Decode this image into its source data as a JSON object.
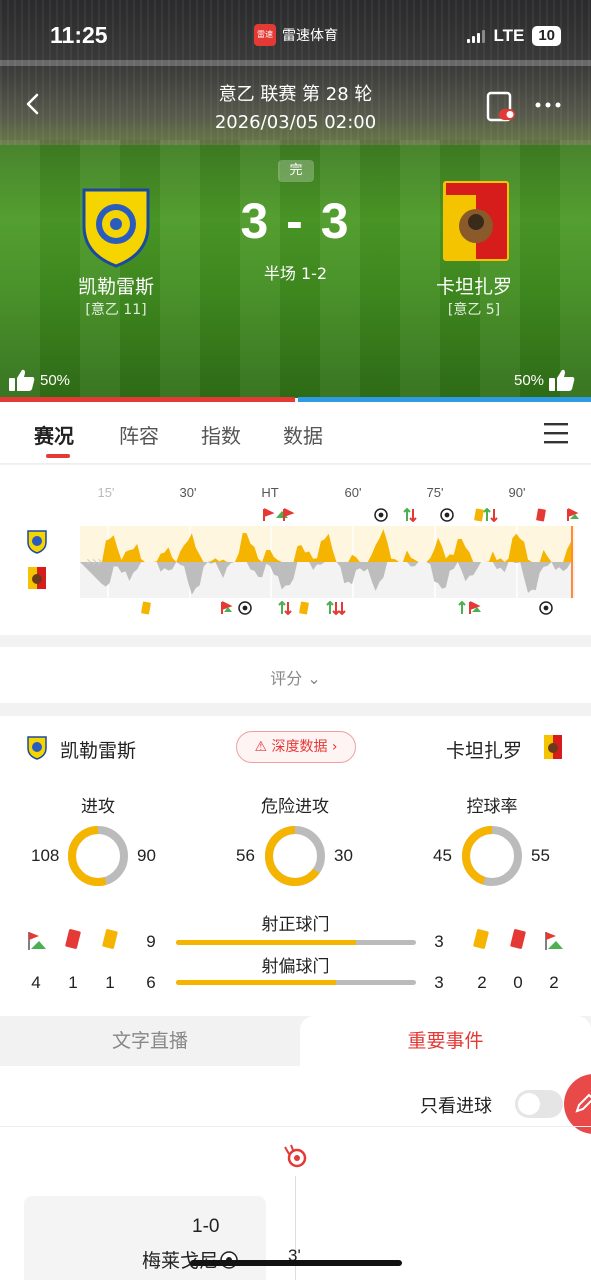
{
  "status": {
    "time": "11:25",
    "app": "雷速体育",
    "app_logo": "雷速",
    "network": "LTE",
    "battery": "10"
  },
  "header": {
    "league": "意乙 联赛 第 28 轮",
    "datetime": "2026/03/05 02:00"
  },
  "match": {
    "status": "完",
    "score": "3 - 3",
    "halftime": "半场 1-2",
    "home": {
      "name": "凯勒雷斯",
      "rank": "[意乙 11]",
      "vote": "50%"
    },
    "away": {
      "name": "卡坦扎罗",
      "rank": "[意乙 5]",
      "vote": "50%"
    }
  },
  "tabs": [
    "赛况",
    "阵容",
    "指数",
    "数据"
  ],
  "momentum": {
    "labels": [
      "15'",
      "30'",
      "HT",
      "60'",
      "75'",
      "90'"
    ]
  },
  "rating": {
    "label": "评分"
  },
  "stats": {
    "home_team": "凯勒雷斯",
    "away_team": "卡坦扎罗",
    "deep_label": "深度数据",
    "donuts": [
      {
        "title": "进攻",
        "home": "108",
        "away": "90",
        "home_value": 108,
        "away_value": 90
      },
      {
        "title": "危险进攻",
        "home": "56",
        "away": "30",
        "home_value": 56,
        "away_value": 30
      },
      {
        "title": "控球率",
        "home": "45",
        "away": "55",
        "home_value": 45,
        "away_value": 55
      }
    ],
    "on_target": {
      "label": "射正球门",
      "home": "9",
      "away": "3",
      "home_value": 9,
      "away_value": 3
    },
    "off_target": {
      "label": "射偏球门",
      "home": "6",
      "away": "3",
      "home_value": 6,
      "away_value": 3
    },
    "home_counts": {
      "corners": "4",
      "red": "1",
      "yellow": "1"
    },
    "away_counts": {
      "yellow": "2",
      "red": "0",
      "corners": "2"
    },
    "colors": {
      "home": "#f5b400",
      "away": "#bbbbbb"
    }
  },
  "lower_tabs": {
    "live_text": "文字直播",
    "key_events": "重要事件"
  },
  "events": {
    "goal_only": "只看进球",
    "first": {
      "score": "1-0",
      "player": "梅莱戈尼",
      "minute": "3'"
    }
  }
}
